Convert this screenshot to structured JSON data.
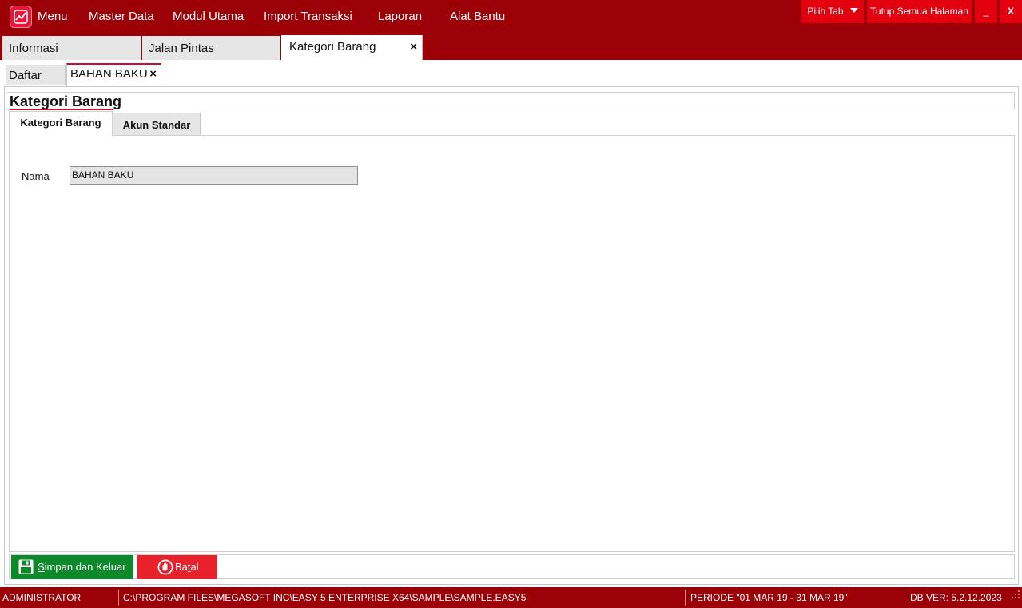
{
  "menubar": {
    "items": [
      "Menu",
      "Master Data",
      "Modul Utama",
      "Import Transaksi",
      "Laporan",
      "Alat Bantu"
    ],
    "pilih_tab": "Pilih Tab",
    "tutup_semua": "Tutup Semua Halaman",
    "minimize": "_",
    "close": "X"
  },
  "main_tabs": {
    "items": [
      "Informasi",
      "Jalan Pintas",
      "Kategori Barang"
    ],
    "close": "×"
  },
  "sub_tabs": {
    "items": [
      "Daftar",
      "BAHAN BAKU"
    ],
    "close": "×"
  },
  "page": {
    "title": "Kategori Barang",
    "tabs": [
      "Kategori Barang",
      "Akun Standar"
    ],
    "form": {
      "nama_label": "Nama",
      "nama_value": "BAHAN BAKU"
    }
  },
  "buttons": {
    "save_prefix": "S",
    "save_rest": "impan dan Keluar",
    "cancel_prefix": "Ba",
    "cancel_accel": "t",
    "cancel_rest": "al"
  },
  "statusbar": {
    "user": "ADMINISTRATOR",
    "path": "C:\\PROGRAM FILES\\MEGASOFT INC\\EASY 5 ENTERPRISE X64\\SAMPLE\\SAMPLE.EASY5",
    "periode": "PERIODE \"01 MAR 19 - 31 MAR 19\"",
    "db_version": "DB VER: 5.2.12.2023"
  },
  "colors": {
    "brand": "#9c0006",
    "accent": "#e3000f",
    "save": "#0c8a2b",
    "cancel": "#e8212b"
  }
}
